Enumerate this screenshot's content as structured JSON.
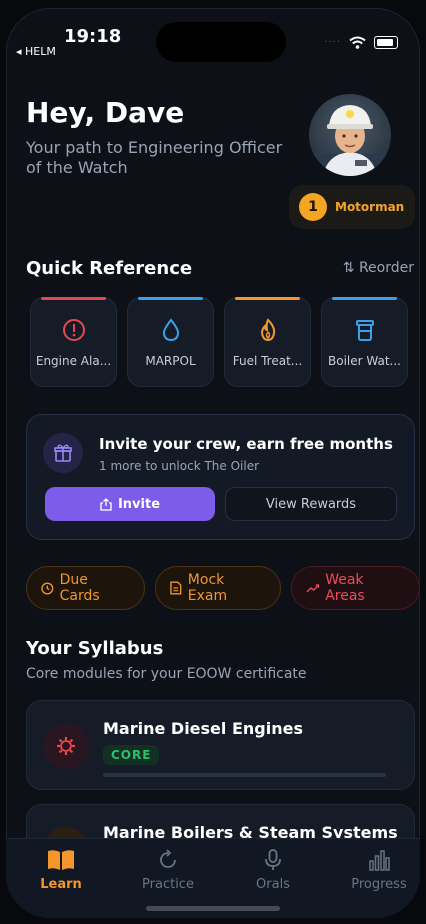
{
  "status": {
    "time": "19:18",
    "back_app": "◂ HELM",
    "signal_dots": "····"
  },
  "header": {
    "greeting": "Hey, Dave",
    "subtitle": "Your path to Engineering Officer of the Watch",
    "rank_number": "1",
    "rank_label": "Motorman"
  },
  "quick_reference": {
    "title": "Quick Reference",
    "reorder_label": "⇅ Reorder",
    "cards": [
      {
        "label": "Engine Ala...",
        "icon": "alert-icon",
        "color": "#e5484d"
      },
      {
        "label": "MARPOL",
        "icon": "water-drop-icon",
        "color": "#3aa0e8"
      },
      {
        "label": "Fuel Treat...",
        "icon": "flame-icon",
        "color": "#f3962b"
      },
      {
        "label": "Boiler Wat...",
        "icon": "beaker-icon",
        "color": "#3aa0e8"
      }
    ]
  },
  "invite": {
    "title": "Invite your crew, earn free months",
    "subtitle": "1 more to unlock The Oiler",
    "invite_label": "Invite",
    "rewards_label": "View Rewards"
  },
  "actions": {
    "due_cards": "Due Cards",
    "mock_exam": "Mock Exam",
    "weak_areas": "Weak Areas"
  },
  "syllabus": {
    "title": "Your Syllabus",
    "subtitle": "Core modules for your EOOW certificate",
    "modules": [
      {
        "title": "Marine Diesel Engines",
        "badge": "CORE"
      },
      {
        "title": "Marine Boilers & Steam Systems"
      }
    ]
  },
  "tabs": {
    "learn": "Learn",
    "practice": "Practice",
    "orals": "Orals",
    "progress": "Progress"
  },
  "colors": {
    "accent": "#f3962b",
    "purple": "#7c5ce8",
    "red": "#f04a5a",
    "green": "#27c26a"
  }
}
